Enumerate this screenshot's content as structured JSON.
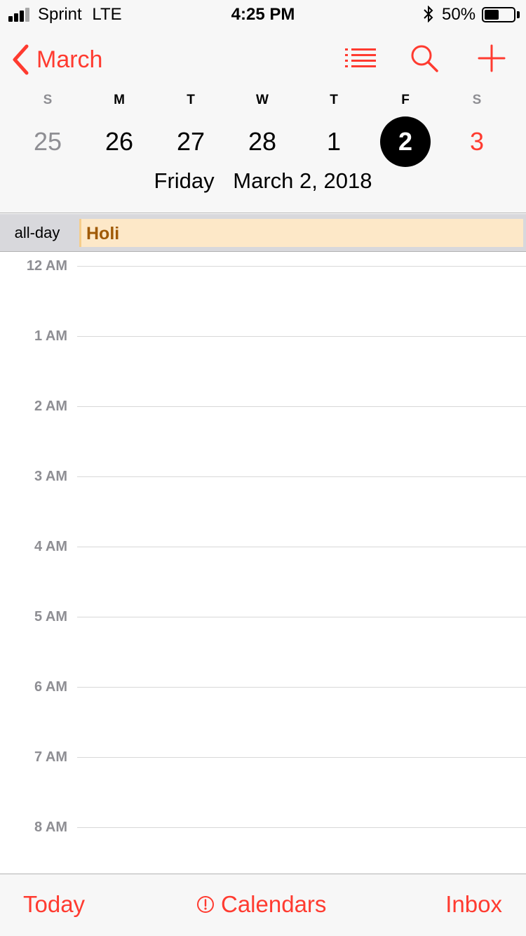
{
  "status_bar": {
    "carrier": "Sprint",
    "network": "LTE",
    "time": "4:25 PM",
    "battery_percent": "50%",
    "battery_level": 0.5,
    "signal_bars": 3,
    "signal_bars_total": 4,
    "icons": [
      "signal-icon",
      "bluetooth-icon",
      "battery-icon"
    ]
  },
  "nav": {
    "back_label": "March",
    "icons": [
      "chevron-left-icon",
      "list-icon",
      "search-icon",
      "plus-icon"
    ]
  },
  "week": {
    "days": [
      {
        "letter": "S",
        "date": "25",
        "style": "muted"
      },
      {
        "letter": "M",
        "date": "26",
        "style": "normal"
      },
      {
        "letter": "T",
        "date": "27",
        "style": "normal"
      },
      {
        "letter": "W",
        "date": "28",
        "style": "normal"
      },
      {
        "letter": "T",
        "date": "1",
        "style": "normal"
      },
      {
        "letter": "F",
        "date": "2",
        "style": "selected"
      },
      {
        "letter": "S",
        "date": "3",
        "style": "red"
      }
    ]
  },
  "selected_day": {
    "weekday": "Friday",
    "date": "March 2, 2018"
  },
  "all_day": {
    "label": "all-day",
    "event": "Holi"
  },
  "hours": [
    "12 AM",
    "1 AM",
    "2 AM",
    "3 AM",
    "4 AM",
    "5 AM",
    "6 AM",
    "7 AM",
    "8 AM"
  ],
  "tab_bar": {
    "today": "Today",
    "calendars": "Calendars",
    "inbox": "Inbox"
  },
  "colors": {
    "accent": "#ff3b30",
    "event_bg": "#fde8c8",
    "event_text": "#a05a05",
    "muted": "#8e8e93"
  }
}
